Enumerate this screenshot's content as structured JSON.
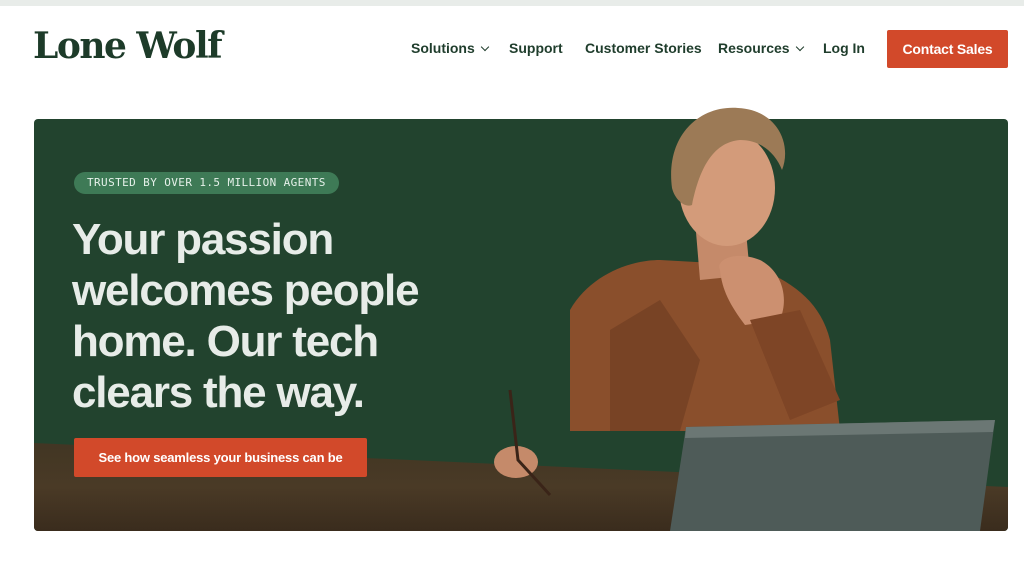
{
  "brand": {
    "name": "Lone Wolf"
  },
  "nav": {
    "items": [
      {
        "label": "Solutions",
        "has_dropdown": true
      },
      {
        "label": "Support",
        "has_dropdown": false
      },
      {
        "label": "Customer Stories",
        "has_dropdown": false
      },
      {
        "label": "Resources",
        "has_dropdown": true
      },
      {
        "label": "Log In",
        "has_dropdown": false
      }
    ],
    "cta_label": "Contact Sales"
  },
  "hero": {
    "badge": "TRUSTED BY OVER 1.5 MILLION AGENTS",
    "headline_lines": [
      "Your passion",
      "welcomes people",
      "home. Our tech",
      "clears the way."
    ],
    "cta_label": "See how seamless your business can be"
  },
  "colors": {
    "brand_green": "#22432e",
    "accent_orange": "#d2492a",
    "badge_green": "#3e7a56",
    "text_dark": "#1f3d2c"
  },
  "icons": {
    "dropdown": "chevron-down-icon"
  }
}
